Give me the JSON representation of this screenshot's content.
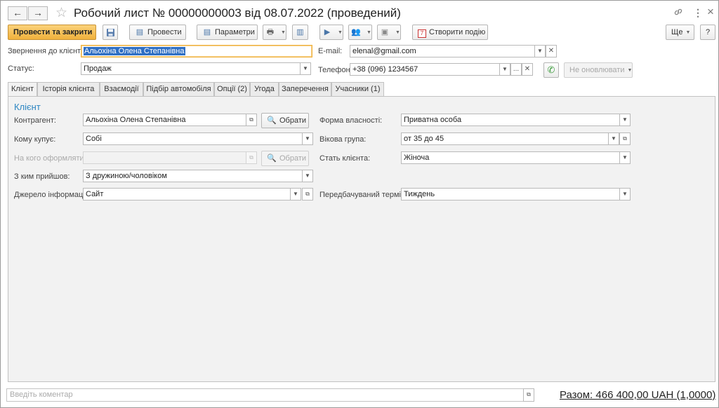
{
  "window": {
    "title": "Робочий лист № 00000000003 від 08.07.2022 (проведений)",
    "back_icon": "←",
    "forward_icon": "→",
    "star_icon": "☆",
    "link_icon": "🔗",
    "more_icon": "⋮",
    "close_icon": "×"
  },
  "toolbar": {
    "post_close_label": "Провести та закрити",
    "post_label": "Провести",
    "params_label": "Параметри",
    "create_event_label": "Створити подію",
    "more_label": "Ще",
    "help_label": "?",
    "calendar_day": "7"
  },
  "form": {
    "appeal_label": "Звернення до клієнта:",
    "appeal_value": "Альохіна Олена Степанівна",
    "status_label": "Статус:",
    "status_value": "Продаж",
    "email_label": "E-mail:",
    "email_value": "elenal@gmail.com",
    "phone_label": "Телефон:",
    "phone_value": "+38 (096) 1234567",
    "no_update_label": "Не оновлювати",
    "dots": "..."
  },
  "tabs": [
    {
      "label": "Клієнт"
    },
    {
      "label": "Історія клієнта"
    },
    {
      "label": "Взаємодії"
    },
    {
      "label": "Підбір автомобіля"
    },
    {
      "label": "Опції (2)"
    },
    {
      "label": "Угода"
    },
    {
      "label": "Заперечення"
    },
    {
      "label": "Учасники (1)"
    }
  ],
  "client": {
    "section_title": "Клієнт",
    "counterparty_label": "Контрагент:",
    "counterparty_value": "Альохіна Олена Степанівна",
    "choose_label": "Обрати",
    "buyer_label": "Кому купує:",
    "buyer_value": "Собі",
    "register_label": "На кого оформляти:",
    "register_value": "",
    "came_with_label": "З ким прийшов:",
    "came_with_value": "З дружиною/чоловіком",
    "source_label": "Джерело інформації:",
    "source_value": "Сайт",
    "ownership_label": "Форма власності:",
    "ownership_value": "Приватна особа",
    "age_label": "Вікова група:",
    "age_value": "от 35 до 45",
    "gender_label": "Стать клієнта:",
    "gender_value": "Жіноча",
    "term_label": "Передбачуваний термін:",
    "term_value": "Тиждень"
  },
  "footer": {
    "comment_placeholder": "Введіть коментар",
    "total": "Разом: 466 400,00 UAH (1,0000)"
  }
}
